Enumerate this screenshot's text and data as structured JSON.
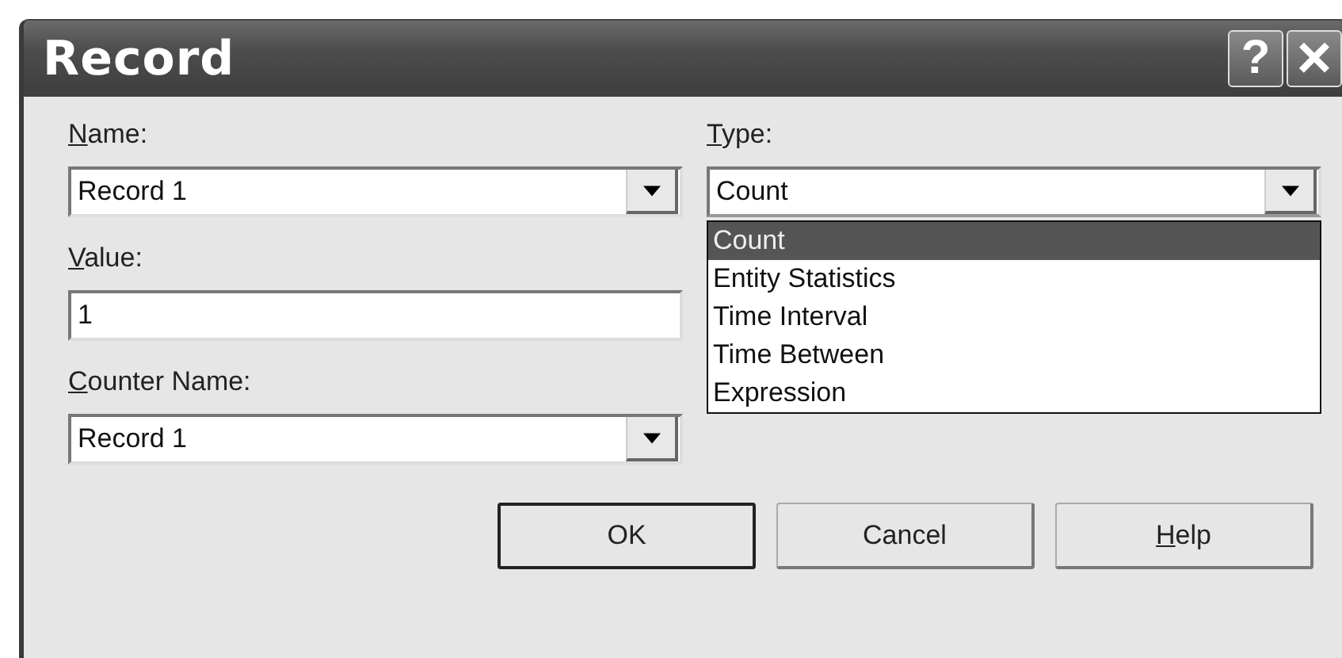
{
  "window": {
    "title": "Record",
    "help_button": "?",
    "close_button": "×"
  },
  "fields": [
    {
      "kind": "combo",
      "label": "Name:",
      "underline_first": true,
      "value": "Record 1"
    },
    {
      "kind": "text",
      "label": "Value:",
      "underline_first": true,
      "value": "1"
    },
    {
      "kind": "combo",
      "label": "Counter Name:",
      "underline_first": true,
      "value": "Record 1"
    }
  ],
  "type": {
    "label": "Type:",
    "underline_first": true,
    "value": "Count",
    "expanded": true,
    "options": [
      {
        "label": "Count",
        "selected": true
      },
      {
        "label": "Entity Statistics",
        "selected": false
      },
      {
        "label": "Time Interval",
        "selected": false
      },
      {
        "label": "Time Between",
        "selected": false
      },
      {
        "label": "Expression",
        "selected": false
      }
    ]
  },
  "buttons": [
    {
      "label": "OK",
      "default": true,
      "underline_first": false
    },
    {
      "label": "Cancel",
      "default": false,
      "underline_first": false
    },
    {
      "label": "Help",
      "default": false,
      "underline_first": true
    }
  ]
}
